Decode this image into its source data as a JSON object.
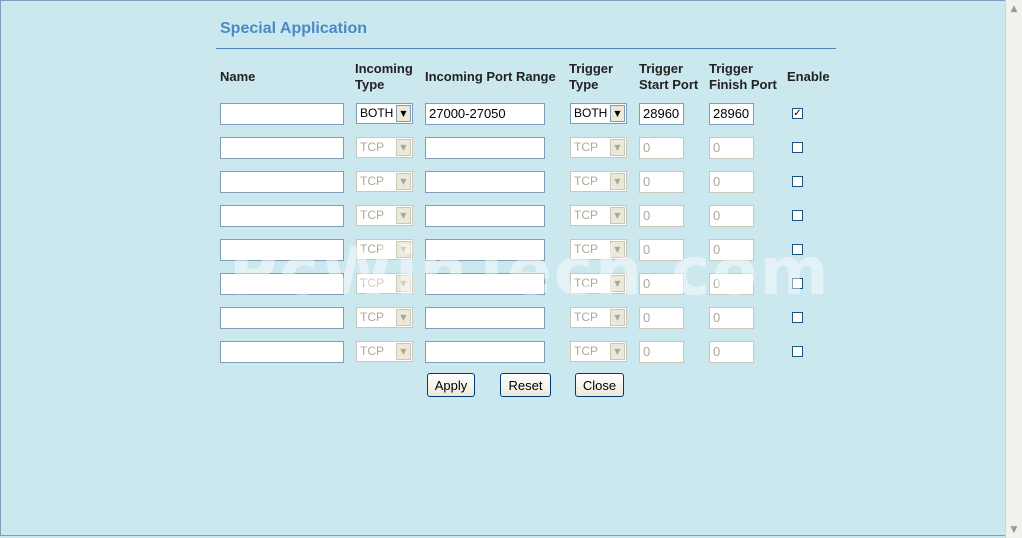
{
  "page": {
    "title": "Special Application",
    "watermark": "PcWinTech.com"
  },
  "headers": {
    "name": "Name",
    "incoming_type": [
      "Incoming",
      "Type"
    ],
    "incoming_port_range": "Incoming Port Range",
    "trigger_type": [
      "Trigger",
      "Type"
    ],
    "trigger_start_port": [
      "Trigger",
      "Start Port"
    ],
    "trigger_finish_port": [
      "Trigger",
      "Finish Port"
    ],
    "enable": "Enable"
  },
  "rows": [
    {
      "name": "",
      "incoming_type": "BOTH",
      "port_range": "27000-27050",
      "trigger_type": "BOTH",
      "trigger_start": "28960",
      "trigger_finish": "28960",
      "enabled": true,
      "disabled": false
    },
    {
      "name": "",
      "incoming_type": "TCP",
      "port_range": "",
      "trigger_type": "TCP",
      "trigger_start": "0",
      "trigger_finish": "0",
      "enabled": false,
      "disabled": true
    },
    {
      "name": "",
      "incoming_type": "TCP",
      "port_range": "",
      "trigger_type": "TCP",
      "trigger_start": "0",
      "trigger_finish": "0",
      "enabled": false,
      "disabled": true
    },
    {
      "name": "",
      "incoming_type": "TCP",
      "port_range": "",
      "trigger_type": "TCP",
      "trigger_start": "0",
      "trigger_finish": "0",
      "enabled": false,
      "disabled": true
    },
    {
      "name": "",
      "incoming_type": "TCP",
      "port_range": "",
      "trigger_type": "TCP",
      "trigger_start": "0",
      "trigger_finish": "0",
      "enabled": false,
      "disabled": true
    },
    {
      "name": "",
      "incoming_type": "TCP",
      "port_range": "",
      "trigger_type": "TCP",
      "trigger_start": "0",
      "trigger_finish": "0",
      "enabled": false,
      "disabled": true
    },
    {
      "name": "",
      "incoming_type": "TCP",
      "port_range": "",
      "trigger_type": "TCP",
      "trigger_start": "0",
      "trigger_finish": "0",
      "enabled": false,
      "disabled": true
    },
    {
      "name": "",
      "incoming_type": "TCP",
      "port_range": "",
      "trigger_type": "TCP",
      "trigger_start": "0",
      "trigger_finish": "0",
      "enabled": false,
      "disabled": true
    }
  ],
  "buttons": {
    "apply": "Apply",
    "reset": "Reset",
    "close": "Close"
  },
  "icons": {
    "dropdown": "chevron-down-icon",
    "scroll_up": "scroll-up-icon",
    "scroll_down": "scroll-down-icon",
    "checkbox_checked": "check-icon"
  },
  "colors": {
    "background": "#cbe8ef",
    "title": "#4a8ac4",
    "rule": "#4a86b8"
  }
}
